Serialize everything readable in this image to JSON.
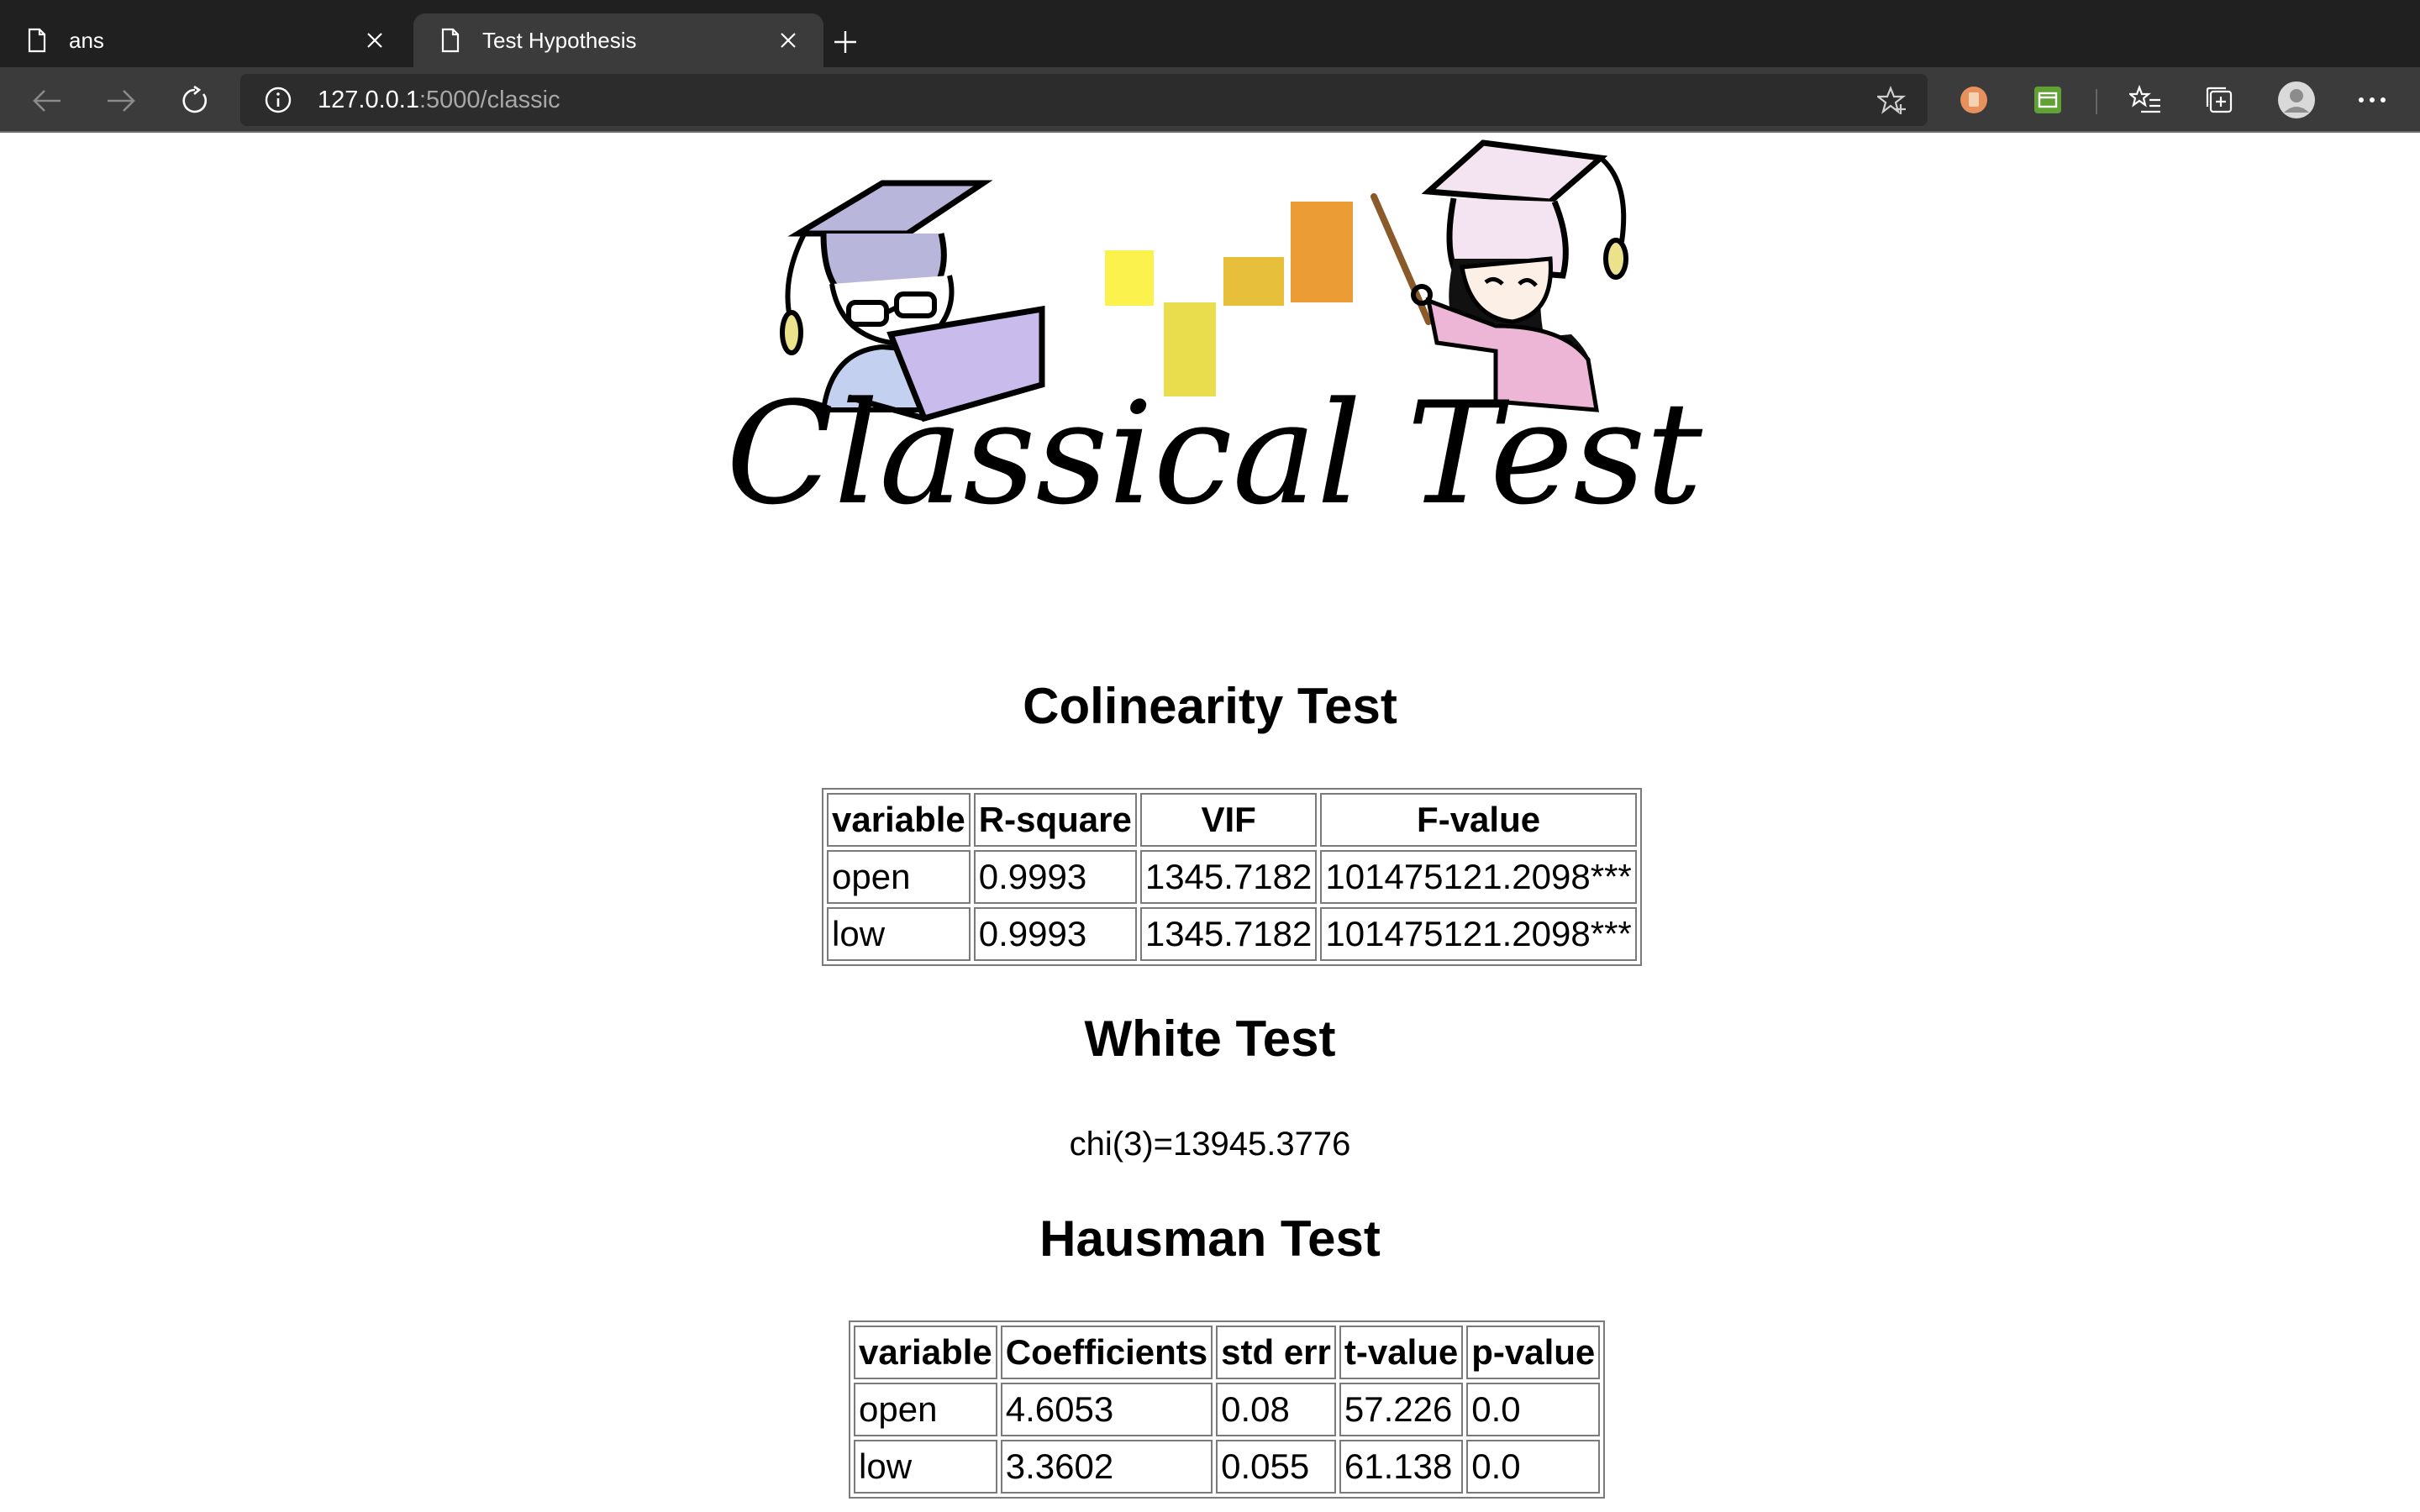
{
  "browser": {
    "tabs": [
      {
        "label": "ans",
        "active": false
      },
      {
        "label": "Test Hypothesis",
        "active": true
      }
    ],
    "address": {
      "host": "127.0.0.1",
      "path": ":5000/classic"
    },
    "colors": {
      "tabbar": "#202020",
      "toolbar": "#3b3b3b",
      "active_tab": "#3b3b3b"
    }
  },
  "logo": {
    "text": "Classical Test",
    "bar_colors": [
      "#fbf24e",
      "#e9dd4e",
      "#e7bf3b",
      "#ec9c34"
    ]
  },
  "colinearity": {
    "title": "Colinearity Test",
    "headers": [
      "variable",
      "R-square",
      "VIF",
      "F-value"
    ],
    "rows": [
      [
        "open",
        "0.9993",
        "1345.7182",
        "101475121.2098***"
      ],
      [
        "low",
        "0.9993",
        "1345.7182",
        "101475121.2098***"
      ]
    ]
  },
  "white": {
    "title": "White Test",
    "result": "chi(3)=13945.3776"
  },
  "hausman": {
    "title": "Hausman Test",
    "headers": [
      "variable",
      "Coefficients",
      "std err",
      "t-value",
      "p-value"
    ],
    "rows": [
      [
        "open",
        "4.6053",
        "0.08",
        "57.226",
        "0.0"
      ],
      [
        "low",
        "3.3602",
        "0.055",
        "61.138",
        "0.0"
      ]
    ]
  }
}
